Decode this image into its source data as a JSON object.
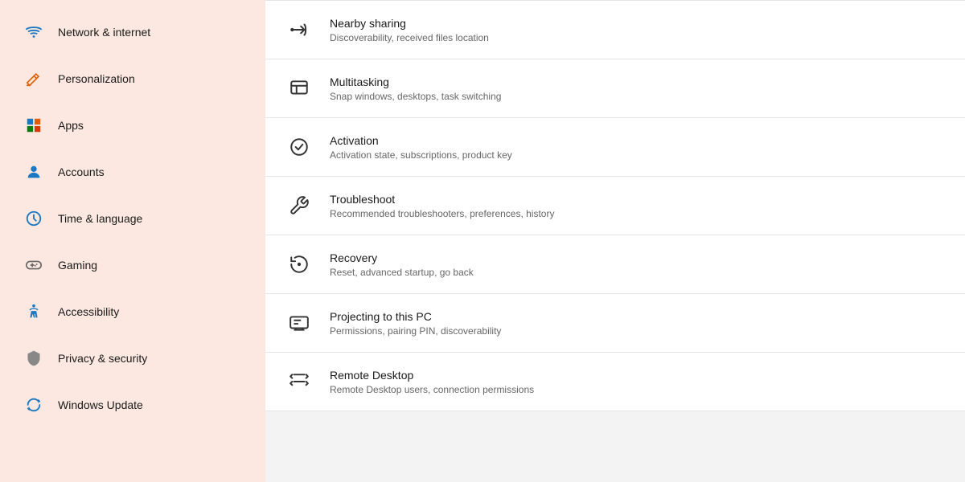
{
  "sidebar": {
    "items": [
      {
        "id": "network",
        "label": "Network & internet",
        "icon": "🌐",
        "emoji": true
      },
      {
        "id": "personalization",
        "label": "Personalization",
        "icon": "✏️",
        "emoji": true
      },
      {
        "id": "apps",
        "label": "Apps",
        "icon": "🟦",
        "emoji": true
      },
      {
        "id": "accounts",
        "label": "Accounts",
        "icon": "👤",
        "emoji": true
      },
      {
        "id": "time",
        "label": "Time & language",
        "icon": "🌍",
        "emoji": true
      },
      {
        "id": "gaming",
        "label": "Gaming",
        "icon": "🎮",
        "emoji": true
      },
      {
        "id": "accessibility",
        "label": "Accessibility",
        "icon": "♿",
        "emoji": true
      },
      {
        "id": "privacy",
        "label": "Privacy & security",
        "icon": "🛡️",
        "emoji": true
      },
      {
        "id": "update",
        "label": "Windows Update",
        "icon": "🔄",
        "emoji": true
      }
    ]
  },
  "main": {
    "items": [
      {
        "id": "nearby-sharing",
        "title": "Nearby sharing",
        "desc": "Discoverability, received files location"
      },
      {
        "id": "multitasking",
        "title": "Multitasking",
        "desc": "Snap windows, desktops, task switching"
      },
      {
        "id": "activation",
        "title": "Activation",
        "desc": "Activation state, subscriptions, product key"
      },
      {
        "id": "troubleshoot",
        "title": "Troubleshoot",
        "desc": "Recommended troubleshooters, preferences, history"
      },
      {
        "id": "recovery",
        "title": "Recovery",
        "desc": "Reset, advanced startup, go back"
      },
      {
        "id": "projecting",
        "title": "Projecting to this PC",
        "desc": "Permissions, pairing PIN, discoverability"
      },
      {
        "id": "remote-desktop",
        "title": "Remote Desktop",
        "desc": "Remote Desktop users, connection permissions"
      }
    ]
  }
}
